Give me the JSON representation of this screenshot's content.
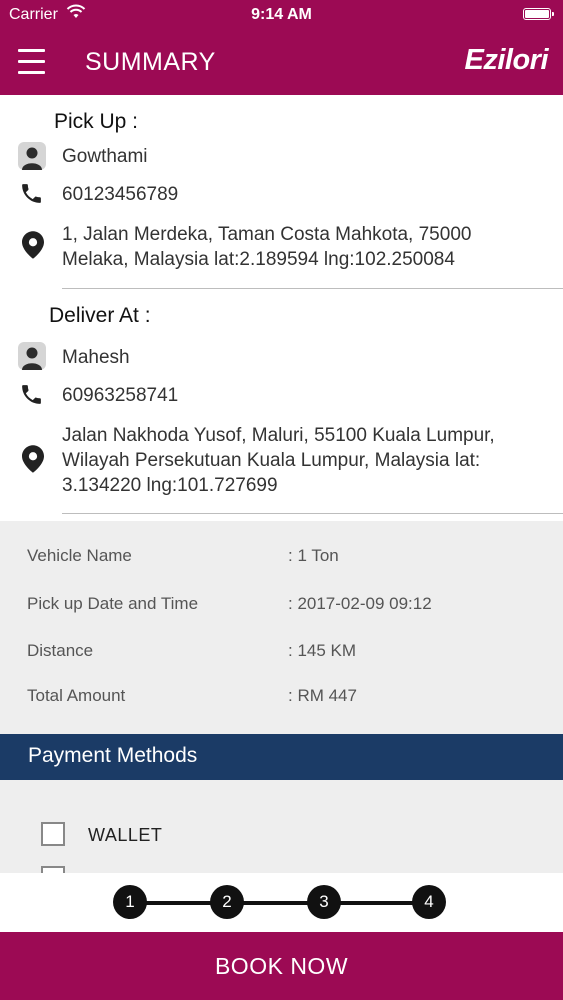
{
  "status_bar": {
    "carrier": "Carrier",
    "time": "9:14 AM"
  },
  "nav": {
    "title": "SUMMARY",
    "logo": "Ezilori"
  },
  "pickup": {
    "heading": "Pick Up :",
    "name": "Gowthami",
    "phone": "60123456789",
    "address_line1": "1, Jalan Merdeka, Taman Costa Mahkota, 75000",
    "address_line2": "Melaka, Malaysia lat:2.189594 lng:102.250084"
  },
  "delivery": {
    "heading": "Deliver At :",
    "name": "Mahesh",
    "phone": "60963258741",
    "address_line1": "Jalan Nakhoda Yusof, Maluri, 55100 Kuala Lumpur,",
    "address_line2": "Wilayah Persekutuan Kuala Lumpur, Malaysia lat:",
    "address_line3": "3.134220 lng:101.727699"
  },
  "summary": [
    {
      "label": "Vehicle Name",
      "value": ": 1 Ton"
    },
    {
      "label": "Pick up Date and Time",
      "value": ": 2017-02-09 09:12"
    },
    {
      "label": "Distance",
      "value": ": 145 KM"
    },
    {
      "label": "Total Amount",
      "value": ": RM 447"
    }
  ],
  "payment": {
    "header": "Payment Methods",
    "options": [
      {
        "label": "WALLET",
        "checked": false
      }
    ]
  },
  "steps": [
    "1",
    "2",
    "3",
    "4"
  ],
  "book_button": "BOOK NOW",
  "colors": {
    "brand": "#9c0a54",
    "payment_header": "#1b3b66",
    "panel": "#eeeeee"
  },
  "icons": [
    "menu-icon",
    "wifi-icon",
    "battery-icon",
    "person-icon",
    "phone-icon",
    "location-pin-icon"
  ]
}
